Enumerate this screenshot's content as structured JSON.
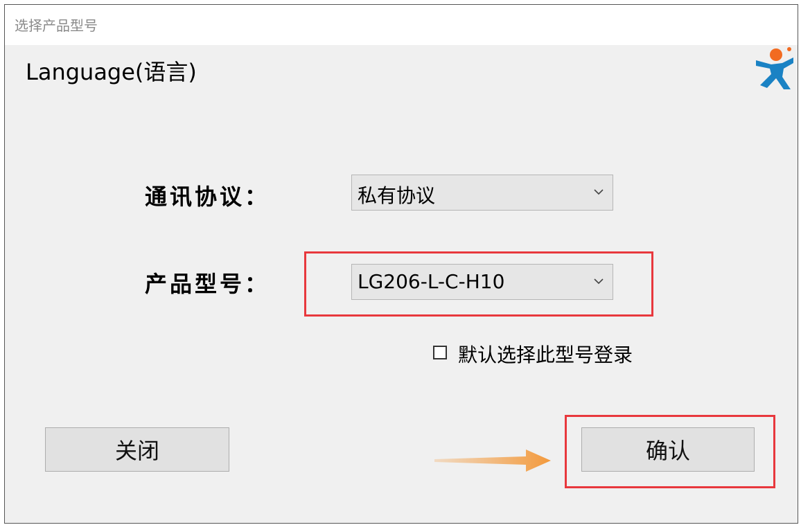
{
  "window": {
    "title": "选择产品型号"
  },
  "language": {
    "label": "Language(语言)"
  },
  "form": {
    "protocol": {
      "label": "通讯协议：",
      "value": "私有协议"
    },
    "model": {
      "label": "产品型号：",
      "value": "LG206-L-C-H10"
    },
    "default_checkbox": {
      "label": "默认选择此型号登录",
      "checked": false
    }
  },
  "buttons": {
    "close": "关闭",
    "confirm": "确认"
  },
  "colors": {
    "highlight": "#e8383d",
    "arrow": "#f39a3d",
    "logo_orange": "#f26b21",
    "logo_blue": "#1a82c4"
  },
  "icons": {
    "logo": "usr-person-logo",
    "dropdown": "chevron-down-icon",
    "annotation_arrow": "arrow-right-icon"
  }
}
